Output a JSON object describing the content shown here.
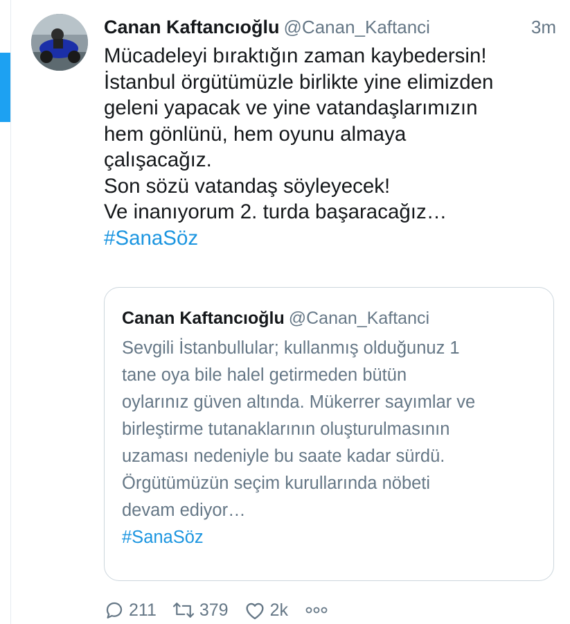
{
  "tweet": {
    "author_name": "Canan Kaftancıoğlu",
    "author_handle": "@Canan_Kaftanci",
    "timestamp": "3m",
    "lines": [
      "Mücadeleyi bıraktığın zaman kaybedersin!",
      "İstanbul örgütümüzle birlikte yine elimizden",
      "geleni yapacak ve yine vatandaşlarımızın",
      "hem gönlünü, hem oyunu almaya",
      "çalışacağız.",
      "Son sözü vatandaş söyleyecek!",
      "Ve inanıyorum 2. turda başaracağız…"
    ],
    "hashtag": "#SanaSöz"
  },
  "quoted": {
    "author_name": "Canan Kaftancıoğlu",
    "author_handle": "@Canan_Kaftanci",
    "lines": [
      "Sevgili İstanbullular; kullanmış olduğunuz 1",
      "tane oya bile halel getirmeden bütün",
      "oylarınız güven altında. Mükerrer sayımlar ve",
      "birleştirme tutanaklarının oluşturulmasının",
      "uzaması nedeniyle bu saate kadar sürdü.",
      "Örgütümüzün seçim kurullarında nöbeti",
      "devam ediyor…"
    ],
    "hashtag": "#SanaSöz"
  },
  "actions": {
    "replies": "211",
    "retweets": "379",
    "likes": "2k"
  },
  "icons": {
    "reply": "reply-icon",
    "retweet": "retweet-icon",
    "like": "heart-icon",
    "more": "more-icon"
  },
  "colors": {
    "accent": "#1da1f2",
    "hashtag": "#1b95e0",
    "secondary_text": "#657786",
    "border": "#ccd6dd"
  }
}
